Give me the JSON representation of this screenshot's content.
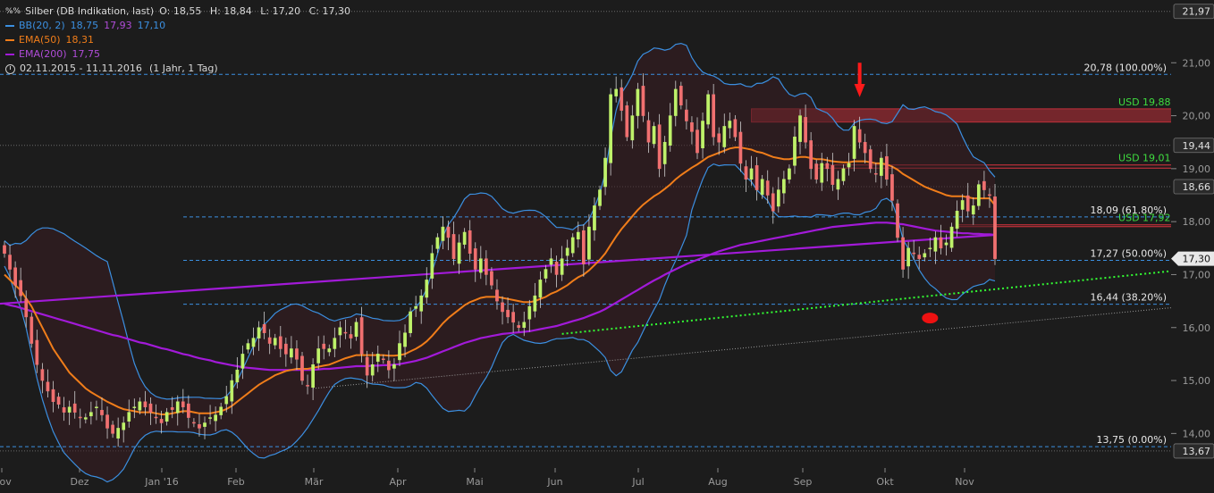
{
  "legend": {
    "instrument": "Silber (DB Indikation, last)",
    "open": "O: 18,55",
    "high": "H: 18,84",
    "low": "L: 17,20",
    "close": "C: 17,30",
    "bb_label": "BB(20, 2)",
    "bb_mid": "18,75",
    "bb_upper": "17,93",
    "bb_lower": "17,10",
    "ema50_label": "EMA(50)",
    "ema50_value": "18,31",
    "ema200_label": "EMA(200)",
    "ema200_value": "17,75",
    "period": "02.11.2015 - 11.11.2016",
    "interval": "(1 Jahr, 1 Tag)"
  },
  "colors": {
    "background": "#1c1c1c",
    "bb": "#3b8fe0",
    "ema50": "#f07d1a",
    "ema200": "#a21ad8",
    "up": "#bff26a",
    "down": "#f07070",
    "fib": "#3b8fe0",
    "resistance": "#c0303a",
    "support_text": "#3fdc3f",
    "trend": "#33ff33"
  },
  "chart_data": {
    "type": "candlestick",
    "title": "Silber (DB Indikation, last)",
    "y_ticks": [
      "14,00",
      "15,00",
      "16,00",
      "17,00",
      "18,00",
      "19,00",
      "20,00",
      "21,00"
    ],
    "ylim": [
      13.5,
      22.05
    ],
    "x_labels": [
      "Nov",
      "Dez",
      "Jan '16",
      "Feb",
      "Mär",
      "Apr",
      "Mai",
      "Jun",
      "Jul",
      "Aug",
      "Sep",
      "Okt",
      "Nov"
    ],
    "price_tags": [
      {
        "label": "21,97",
        "value": 21.97,
        "style": "box"
      },
      {
        "label": "19,44",
        "value": 19.44,
        "style": "box"
      },
      {
        "label": "18,66",
        "value": 18.66,
        "style": "box"
      },
      {
        "label": "17,30",
        "value": 17.3,
        "style": "current"
      },
      {
        "label": "13,67",
        "value": 13.67,
        "style": "box"
      }
    ],
    "fib_levels": [
      {
        "label": "20,78 (100.00%)",
        "value": 20.78
      },
      {
        "label": "18,09 (61.80%)",
        "value": 18.09
      },
      {
        "label": "17,27 (50.00%)",
        "value": 17.27
      },
      {
        "label": "16,44 (38.20%)",
        "value": 16.44
      },
      {
        "label": "13,75 (0.00%)",
        "value": 13.75
      }
    ],
    "zones": [
      {
        "label": "USD 19,88-20,13",
        "low": 19.88,
        "high": 20.13,
        "fill": true
      },
      {
        "label": "USD 19,01-19,07",
        "low": 19.01,
        "high": 19.07,
        "fill": false
      },
      {
        "label": "USD 17,92-17,94",
        "low": 17.92,
        "high": 17.94,
        "fill": false
      }
    ],
    "close_series": [
      17.4,
      17.1,
      16.8,
      16.6,
      16.2,
      15.7,
      15.3,
      15.0,
      14.8,
      14.6,
      14.55,
      14.4,
      14.5,
      14.4,
      14.3,
      14.3,
      14.4,
      14.5,
      14.35,
      14.1,
      14.0,
      14.1,
      14.2,
      14.4,
      14.5,
      14.6,
      14.5,
      14.4,
      14.3,
      14.2,
      14.4,
      14.45,
      14.6,
      14.5,
      14.3,
      14.2,
      14.1,
      14.2,
      14.3,
      14.35,
      14.5,
      14.7,
      15.0,
      15.2,
      15.5,
      15.7,
      15.8,
      16.0,
      15.9,
      15.7,
      15.8,
      15.6,
      15.5,
      15.6,
      15.4,
      15.0,
      14.9,
      15.3,
      15.6,
      15.6,
      15.6,
      15.8,
      16.0,
      15.9,
      15.8,
      16.1,
      15.5,
      15.1,
      15.3,
      15.5,
      15.4,
      15.2,
      15.3,
      15.7,
      15.9,
      16.3,
      16.4,
      16.6,
      16.9,
      17.4,
      17.7,
      17.9,
      17.7,
      17.3,
      17.6,
      17.8,
      17.4,
      17.1,
      17.3,
      17.0,
      16.8,
      16.5,
      16.3,
      16.2,
      16.1,
      16.0,
      16.1,
      16.4,
      16.6,
      16.9,
      17.1,
      17.3,
      17.0,
      17.3,
      17.5,
      17.7,
      17.8,
      17.2,
      17.9,
      18.3,
      18.6,
      19.2,
      20.4,
      20.5,
      20.1,
      19.6,
      20.0,
      20.5,
      20.0,
      19.5,
      19.8,
      19.0,
      19.5,
      20.0,
      20.5,
      20.2,
      19.9,
      19.7,
      19.3,
      19.9,
      20.4,
      19.6,
      19.5,
      19.8,
      19.9,
      19.6,
      19.1,
      18.8,
      19.0,
      18.6,
      18.8,
      18.5,
      18.2,
      18.6,
      18.8,
      19.0,
      19.6,
      20.0,
      19.5,
      19.0,
      18.8,
      19.1,
      19.0,
      18.7,
      18.8,
      19.0,
      19.1,
      19.8,
      19.5,
      19.3,
      19.0,
      18.9,
      19.2,
      18.8,
      18.4,
      17.7,
      17.1,
      17.5,
      17.4,
      17.3,
      17.4,
      17.5,
      17.7,
      17.5,
      17.6,
      17.9,
      18.2,
      18.4,
      18.2,
      18.3,
      18.7,
      18.6,
      18.5,
      17.3
    ],
    "ema50_series": [
      17.0,
      16.9,
      16.8,
      16.7,
      16.55,
      16.4,
      16.2,
      16.0,
      15.8,
      15.6,
      15.45,
      15.3,
      15.15,
      15.05,
      14.95,
      14.85,
      14.78,
      14.72,
      14.66,
      14.6,
      14.55,
      14.5,
      14.46,
      14.44,
      14.42,
      14.4,
      14.4,
      14.4,
      14.38,
      14.36,
      14.36,
      14.38,
      14.4,
      14.42,
      14.42,
      14.4,
      14.38,
      14.38,
      14.38,
      14.4,
      14.42,
      14.46,
      14.52,
      14.6,
      14.68,
      14.76,
      14.84,
      14.92,
      14.98,
      15.04,
      15.1,
      15.14,
      15.18,
      15.2,
      15.22,
      15.22,
      15.22,
      15.24,
      15.26,
      15.28,
      15.3,
      15.34,
      15.38,
      15.42,
      15.45,
      15.48,
      15.48,
      15.48,
      15.48,
      15.48,
      15.48,
      15.47,
      15.47,
      15.48,
      15.5,
      15.55,
      15.6,
      15.66,
      15.74,
      15.84,
      15.96,
      16.08,
      16.18,
      16.26,
      16.34,
      16.42,
      16.48,
      16.52,
      16.56,
      16.58,
      16.58,
      16.58,
      16.56,
      16.54,
      16.52,
      16.5,
      16.48,
      16.48,
      16.5,
      16.54,
      16.58,
      16.64,
      16.68,
      16.74,
      16.8,
      16.88,
      16.95,
      17.0,
      17.08,
      17.18,
      17.28,
      17.4,
      17.56,
      17.72,
      17.86,
      17.98,
      18.1,
      18.22,
      18.32,
      18.4,
      18.48,
      18.54,
      18.62,
      18.7,
      18.8,
      18.88,
      18.95,
      19.02,
      19.08,
      19.15,
      19.22,
      19.26,
      19.3,
      19.34,
      19.38,
      19.4,
      19.4,
      19.38,
      19.36,
      19.32,
      19.3,
      19.26,
      19.22,
      19.2,
      19.18,
      19.18,
      19.2,
      19.22,
      19.22,
      19.2,
      19.18,
      19.18,
      19.16,
      19.14,
      19.13,
      19.12,
      19.12,
      19.14,
      19.14,
      19.14,
      19.12,
      19.1,
      19.1,
      19.08,
      19.04,
      18.98,
      18.9,
      18.84,
      18.78,
      18.72,
      18.66,
      18.62,
      18.58,
      18.54,
      18.5,
      18.48,
      18.48,
      18.48,
      18.46,
      18.44,
      18.44,
      18.44,
      18.44,
      18.31
    ],
    "ema200_series": [
      16.45,
      16.42,
      16.4,
      16.37,
      16.34,
      16.31,
      16.28,
      16.25,
      16.22,
      16.19,
      16.16,
      16.13,
      16.1,
      16.07,
      16.04,
      16.01,
      15.98,
      15.95,
      15.92,
      15.89,
      15.86,
      15.84,
      15.81,
      15.78,
      15.75,
      15.72,
      15.7,
      15.67,
      15.64,
      15.61,
      15.59,
      15.56,
      15.53,
      15.5,
      15.48,
      15.45,
      15.42,
      15.4,
      15.38,
      15.35,
      15.33,
      15.31,
      15.29,
      15.27,
      15.25,
      15.24,
      15.23,
      15.22,
      15.21,
      15.2,
      15.2,
      15.2,
      15.2,
      15.2,
      15.2,
      15.2,
      15.2,
      15.2,
      15.21,
      15.22,
      15.22,
      15.23,
      15.24,
      15.25,
      15.26,
      15.27,
      15.27,
      15.27,
      15.28,
      15.28,
      15.29,
      15.29,
      15.3,
      15.31,
      15.33,
      15.35,
      15.37,
      15.4,
      15.43,
      15.47,
      15.51,
      15.55,
      15.59,
      15.63,
      15.67,
      15.71,
      15.74,
      15.77,
      15.8,
      15.82,
      15.84,
      15.86,
      15.88,
      15.89,
      15.9,
      15.91,
      15.92,
      15.93,
      15.95,
      15.97,
      15.99,
      16.01,
      16.03,
      16.06,
      16.09,
      16.12,
      16.15,
      16.18,
      16.22,
      16.26,
      16.3,
      16.35,
      16.41,
      16.47,
      16.53,
      16.59,
      16.65,
      16.71,
      16.77,
      16.83,
      16.89,
      16.94,
      17.0,
      17.05,
      17.1,
      17.15,
      17.2,
      17.24,
      17.28,
      17.32,
      17.36,
      17.4,
      17.44,
      17.47,
      17.5,
      17.53,
      17.56,
      17.58,
      17.6,
      17.62,
      17.64,
      17.66,
      17.68,
      17.7,
      17.72,
      17.74,
      17.76,
      17.78,
      17.8,
      17.82,
      17.84,
      17.86,
      17.88,
      17.9,
      17.91,
      17.92,
      17.93,
      17.94,
      17.95,
      17.96,
      17.97,
      17.98,
      17.98,
      17.98,
      17.97,
      17.96,
      17.95,
      17.93,
      17.91,
      17.89,
      17.87,
      17.85,
      17.83,
      17.82,
      17.81,
      17.8,
      17.79,
      17.78,
      17.78,
      17.77,
      17.77,
      17.76,
      17.76,
      17.75
    ]
  }
}
